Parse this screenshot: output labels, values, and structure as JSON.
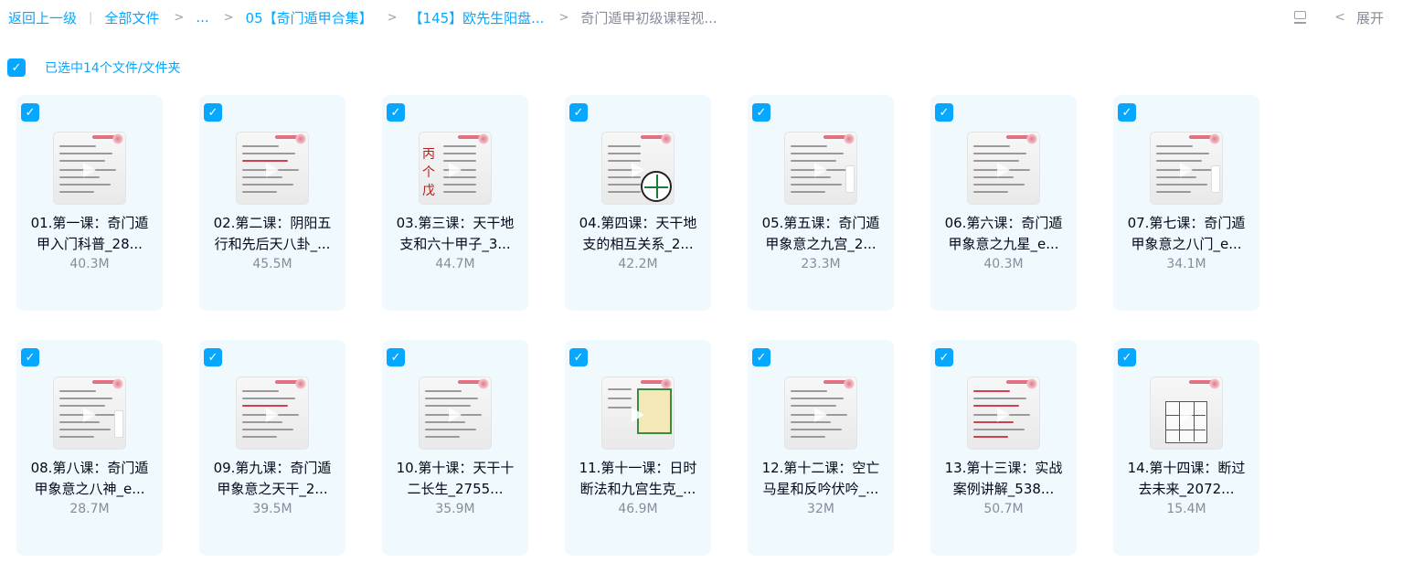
{
  "breadcrumb": {
    "back": "返回上一级",
    "separator_bar": "|",
    "items": [
      "全部文件",
      "...",
      "05【奇门遁甲合集】",
      "【145】欧先生阳盘..."
    ],
    "current": "奇门遁甲初级课程视...",
    "separator": ">"
  },
  "toolbar": {
    "list_icon": "list-view-icon",
    "chevron": "<",
    "expand_label": "展开"
  },
  "selection": {
    "checked": true,
    "text": "已选中14个文件/文件夹"
  },
  "accent_color": "#06a7ff",
  "files": [
    {
      "name_line1": "01.第一课：奇门遁",
      "name_line2": "甲入门科普_28...",
      "size": "40.3M",
      "thumb": "text"
    },
    {
      "name_line1": "02.第二课：阴阳五",
      "name_line2": "行和先后天八卦_...",
      "size": "45.5M",
      "thumb": "text"
    },
    {
      "name_line1": "03.第三课：天干地",
      "name_line2": "支和六十甲子_3...",
      "size": "44.7M",
      "thumb": "glyphs"
    },
    {
      "name_line1": "04.第四课：天干地",
      "name_line2": "支的相互关系_2...",
      "size": "42.2M",
      "thumb": "bagua"
    },
    {
      "name_line1": "05.第五课：奇门遁",
      "name_line2": "甲象意之九宫_2...",
      "size": "23.3M",
      "thumb": "side"
    },
    {
      "name_line1": "06.第六课：奇门遁",
      "name_line2": "甲象意之九星_e...",
      "size": "40.3M",
      "thumb": "text"
    },
    {
      "name_line1": "07.第七课：奇门遁",
      "name_line2": "甲象意之八门_e...",
      "size": "34.1M",
      "thumb": "side"
    },
    {
      "name_line1": "08.第八课：奇门遁",
      "name_line2": "甲象意之八神_e...",
      "size": "28.7M",
      "thumb": "side"
    },
    {
      "name_line1": "09.第九课：奇门遁",
      "name_line2": "甲象意之天干_2...",
      "size": "39.5M",
      "thumb": "text"
    },
    {
      "name_line1": "10.第十课：天干十",
      "name_line2": "二长生_2755...",
      "size": "35.9M",
      "thumb": "text"
    },
    {
      "name_line1": "11.第十一课：日时",
      "name_line2": "断法和九宫生克_...",
      "size": "46.9M",
      "thumb": "table"
    },
    {
      "name_line1": "12.第十二课：空亡",
      "name_line2": "马星和反吟伏吟_...",
      "size": "32M",
      "thumb": "text"
    },
    {
      "name_line1": "13.第十三课：实战",
      "name_line2": "案例讲解_538...",
      "size": "50.7M",
      "thumb": "red"
    },
    {
      "name_line1": "14.第十四课：断过",
      "name_line2": "去未来_2072...",
      "size": "15.4M",
      "thumb": "grid9"
    }
  ],
  "thumb_glyphs": [
    "丙",
    "个",
    "戊"
  ]
}
